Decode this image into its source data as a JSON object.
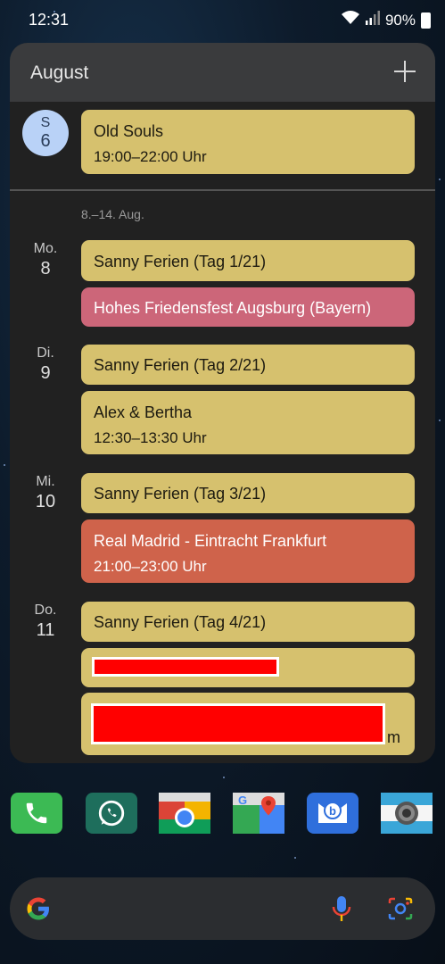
{
  "status": {
    "time": "12:31",
    "battery": "90%"
  },
  "widget": {
    "month": "August",
    "prev_day": {
      "dow": "S",
      "num": "6"
    },
    "prev_event": {
      "title": "Old Souls",
      "time": "19:00–22:00 Uhr"
    },
    "week_range": "8.–14. Aug.",
    "days": [
      {
        "dow": "Mo.",
        "num": "8"
      },
      {
        "dow": "Di.",
        "num": "9"
      },
      {
        "dow": "Mi.",
        "num": "10"
      },
      {
        "dow": "Do.",
        "num": "11"
      }
    ],
    "events": {
      "mo1": {
        "title": "Sanny Ferien (Tag 1/21)"
      },
      "mo2": {
        "title": "Hohes Friedensfest Augsburg (Bayern)"
      },
      "di1": {
        "title": "Sanny Ferien (Tag 2/21)"
      },
      "di2": {
        "title": "Alex & Bertha",
        "time": "12:30–13:30 Uhr"
      },
      "mi1": {
        "title": "Sanny Ferien (Tag 3/21)"
      },
      "mi2": {
        "title": "Real Madrid - Eintracht Frankfurt",
        "time": "21:00–23:00 Uhr"
      },
      "do1": {
        "title": "Sanny Ferien (Tag 4/21)"
      },
      "do3": {
        "suffix": "m"
      }
    },
    "colors": {
      "yellow": "#d6c16e",
      "pink": "#cc6679",
      "orange": "#cf634b"
    }
  },
  "dock": [
    {
      "name": "phone-app-icon"
    },
    {
      "name": "whatsapp-app-icon"
    },
    {
      "name": "chrome-app-icon"
    },
    {
      "name": "maps-app-icon"
    },
    {
      "name": "bixby-app-icon"
    },
    {
      "name": "camera-app-icon"
    }
  ]
}
